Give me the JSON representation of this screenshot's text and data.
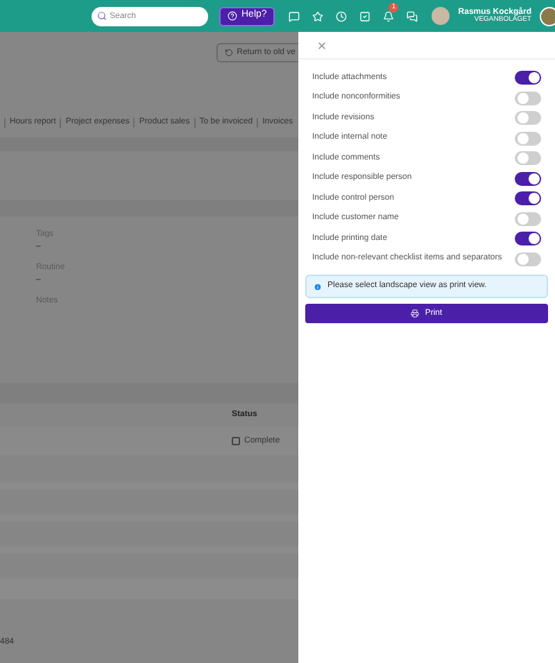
{
  "header": {
    "search": {
      "placeholder": "Search"
    },
    "help_button": "Help?",
    "notification_count": "1",
    "user": {
      "name": "Rasmus Kockgård",
      "company": "VEGANBOLAGET"
    }
  },
  "background": {
    "return_button": "Return to old ve",
    "tabs": [
      "Hours report",
      "Project expenses",
      "Product sales",
      "To be invoiced",
      "Invoices"
    ],
    "fields": [
      {
        "label": "Tags",
        "value": "–"
      },
      {
        "label": "Routine",
        "value": "–"
      },
      {
        "label": "Notes"
      }
    ],
    "status_column": "Status",
    "status_item": {
      "label": "Complete",
      "checked": false
    },
    "footer_number": "484"
  },
  "drawer": {
    "options": [
      {
        "label": "Include attachments",
        "on": true
      },
      {
        "label": "Include nonconformities",
        "on": false
      },
      {
        "label": "Include revisions",
        "on": false
      },
      {
        "label": "Include internal note",
        "on": false
      },
      {
        "label": "Include comments",
        "on": false
      },
      {
        "label": "Include responsible person",
        "on": true
      },
      {
        "label": "Include control person",
        "on": true
      },
      {
        "label": "Include customer name",
        "on": false
      },
      {
        "label": "Include printing date",
        "on": true
      },
      {
        "label": "Include non-relevant checklist items and separators",
        "on": false
      }
    ],
    "info": "Please select landscape view as print view.",
    "print_button": "Print"
  }
}
